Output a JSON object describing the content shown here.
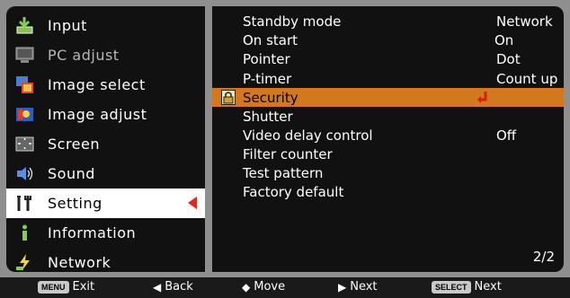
{
  "menu": {
    "items": [
      {
        "label": "Input",
        "icon": "input-icon",
        "dim": false
      },
      {
        "label": "PC adjust",
        "icon": "pc-adjust-icon",
        "dim": true
      },
      {
        "label": "Image select",
        "icon": "image-select-icon",
        "dim": false
      },
      {
        "label": "Image adjust",
        "icon": "image-adjust-icon",
        "dim": false
      },
      {
        "label": "Screen",
        "icon": "screen-icon",
        "dim": false
      },
      {
        "label": "Sound",
        "icon": "sound-icon",
        "dim": false
      },
      {
        "label": "Setting",
        "icon": "setting-icon",
        "dim": false,
        "selected": true
      },
      {
        "label": "Information",
        "icon": "information-icon",
        "dim": false
      },
      {
        "label": "Network",
        "icon": "network-icon",
        "dim": false
      }
    ]
  },
  "setting": {
    "rows": [
      {
        "label": "Standby mode",
        "value": "Network"
      },
      {
        "label": "On start",
        "value": "On"
      },
      {
        "label": "Pointer",
        "value": "Dot"
      },
      {
        "label": "P-timer",
        "value": "Count up"
      },
      {
        "label": "Security",
        "value": ""
      },
      {
        "label": "Shutter",
        "value": ""
      },
      {
        "label": "Video delay control",
        "value": "Off"
      },
      {
        "label": "Filter counter",
        "value": ""
      },
      {
        "label": "Test pattern",
        "value": ""
      },
      {
        "label": "Factory default",
        "value": ""
      }
    ],
    "page": "2/2"
  },
  "footer": {
    "exit_key": "MENU",
    "exit_label": "Exit",
    "back_glyph": "◀",
    "back_label": "Back",
    "move_glyph": "◆",
    "move_label": "Move",
    "next_glyph": "▶",
    "next_label": "Next",
    "select_key": "SELECT",
    "select_label": "Next"
  },
  "colors": {
    "highlight": "#d4781f",
    "selected_arrow": "#e0281e",
    "panel": "#111111",
    "background": "#8f8f8f"
  }
}
